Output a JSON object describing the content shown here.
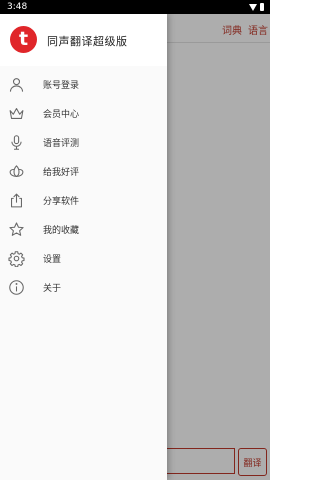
{
  "status_bar": {
    "time": "3:48"
  },
  "app": {
    "top_links": {
      "dictionary": "词典",
      "language": "语言"
    },
    "translate_button": "翻译"
  },
  "drawer": {
    "logo_letter": "t",
    "app_name": "同声翻译超级版",
    "menu": [
      {
        "label": "账号登录",
        "icon": "user-icon"
      },
      {
        "label": "会员中心",
        "icon": "crown-icon"
      },
      {
        "label": "语音评测",
        "icon": "microphone-icon"
      },
      {
        "label": "给我好评",
        "icon": "lotus-icon"
      },
      {
        "label": "分享软件",
        "icon": "share-icon"
      },
      {
        "label": "我的收藏",
        "icon": "star-icon"
      },
      {
        "label": "设置",
        "icon": "gear-icon"
      },
      {
        "label": "关于",
        "icon": "info-icon"
      }
    ]
  },
  "colors": {
    "brand_red": "#e0262a",
    "accent_red": "#c0392b",
    "scrim": "rgba(0,0,0,0.32)"
  }
}
